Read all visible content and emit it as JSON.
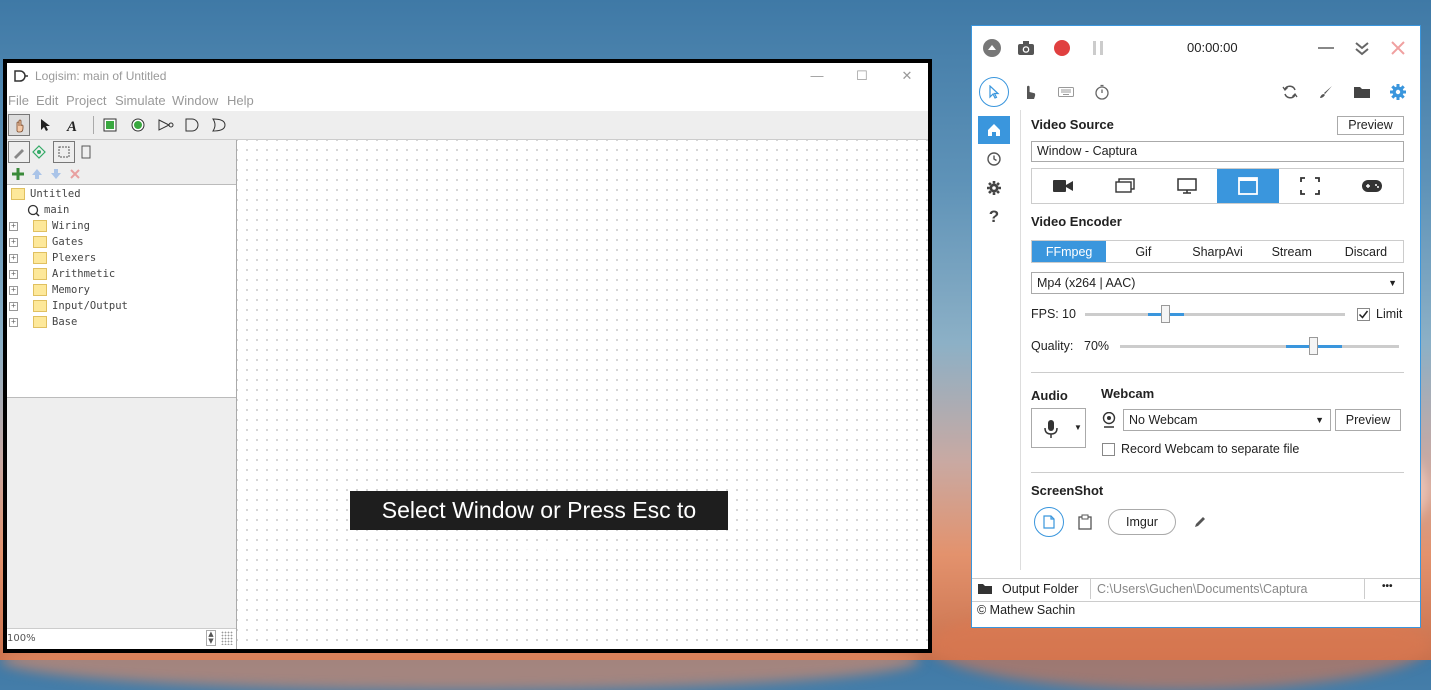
{
  "logisim": {
    "title": "Logisim: main of Untitled",
    "window_buttons": [
      "—",
      "☐",
      "✕"
    ],
    "menu": [
      "File",
      "Edit",
      "Project",
      "Simulate",
      "Window",
      "Help"
    ],
    "tree": {
      "root": "Untitled",
      "circuit": "main",
      "libraries": [
        "Wiring",
        "Gates",
        "Plexers",
        "Arithmetic",
        "Memory",
        "Input/Output",
        "Base"
      ]
    },
    "zoom": "100%",
    "banner": "Select Window or Press Esc to Cancel"
  },
  "captura": {
    "timer": "00:00:00",
    "video_source": {
      "title": "Video Source",
      "preview_label": "Preview",
      "value": "Window - Captura"
    },
    "video_encoder": {
      "title": "Video Encoder",
      "tabs": [
        "FFmpeg",
        "Gif",
        "SharpAvi",
        "Stream",
        "Discard"
      ],
      "active_tab": "FFmpeg",
      "format": "Mp4 (x264 | AAC)"
    },
    "fps": {
      "label": "FPS:",
      "value": "10",
      "limit_label": "Limit",
      "limit_checked": true
    },
    "quality": {
      "label": "Quality:",
      "value": "70%"
    },
    "audio": {
      "title": "Audio"
    },
    "webcam": {
      "title": "Webcam",
      "value": "No Webcam",
      "preview_label": "Preview",
      "separate_file_label": "Record Webcam to separate file"
    },
    "screenshot": {
      "title": "ScreenShot",
      "imgur_label": "Imgur"
    },
    "output_folder": {
      "label": "Output Folder",
      "path": "C:\\Users\\Guchen\\Documents\\Captura",
      "more": "•••"
    },
    "copyright": "© Mathew Sachin"
  },
  "colors": {
    "accent": "#3a96dd",
    "record": "#e04040"
  }
}
